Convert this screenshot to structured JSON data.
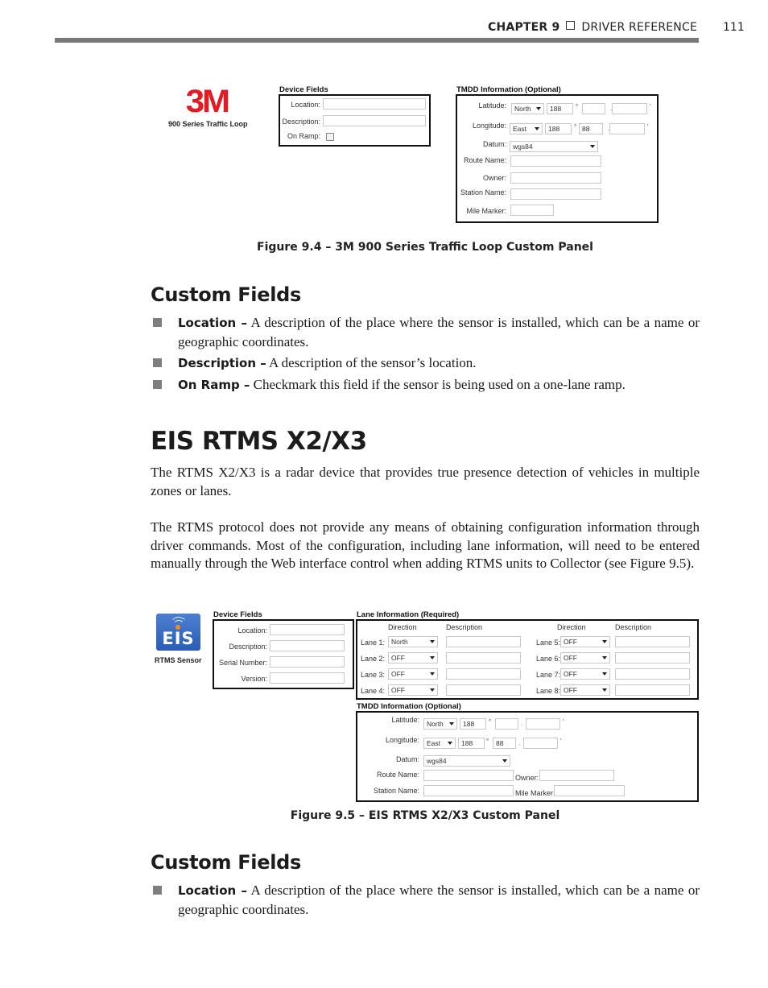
{
  "header": {
    "chapter": "CHAPTER 9",
    "section": "DRIVER REFERENCE",
    "page_number": "111"
  },
  "figure_94": {
    "logo_text": "3M",
    "device_name": "900 Series Traffic Loop",
    "device_fields": {
      "title": "Device Fields",
      "location_label": "Location:",
      "location_value": "",
      "description_label": "Description:",
      "description_value": "",
      "on_ramp_label": "On Ramp:",
      "on_ramp_checked": false
    },
    "tmdd": {
      "title": "TMDD Information (Optional)",
      "latitude_label": "Latitude:",
      "latitude_dir": "North",
      "latitude_deg": "188",
      "latitude_min": "",
      "latitude_sec": "",
      "longitude_label": "Longitude:",
      "longitude_dir": "East",
      "longitude_deg": "188",
      "longitude_min": "88",
      "longitude_sec": "",
      "datum_label": "Datum:",
      "datum_value": "wgs84",
      "route_name_label": "Route Name:",
      "owner_label": "Owner:",
      "station_name_label": "Station Name:",
      "mile_marker_label": "Mile Marker:",
      "deg_symbol": "°",
      "dot": ".",
      "min_symbol": "'"
    },
    "caption": "Figure 9.4 – 3M 900 Series Traffic Loop Custom Panel"
  },
  "section1": {
    "heading": "Custom Fields",
    "bullets": [
      {
        "term": "Location –",
        "text": " A description of the place where the sensor is installed, which can be a name or geographic coordinates."
      },
      {
        "term": "Description –",
        "text": " A description of the sensor’s location."
      },
      {
        "term": "On Ramp –",
        "text": " Checkmark this field if the sensor is being used on a one-lane ramp."
      }
    ]
  },
  "eis_section": {
    "heading": "EIS RTMS X2/X3",
    "para1": "The RTMS X2/X3 is a radar device that provides true presence detection of vehicles in multiple zones or lanes.",
    "para2": "The RTMS protocol does not provide any means of obtaining configuration information through driver commands. Most of the configuration, including lane information, will need to be entered manually through the Web interface control when adding RTMS units to Collector (see Figure 9.5)."
  },
  "figure_95": {
    "logo_text": "EIS",
    "device_name": "RTMS Sensor",
    "device_fields": {
      "title": "Device Fields",
      "location_label": "Location:",
      "description_label": "Description:",
      "serial_label": "Serial Number:",
      "version_label": "Version:"
    },
    "lanes": {
      "title": "Lane Information (Required)",
      "direction_header": "Direction",
      "description_header": "Description",
      "items": [
        {
          "label": "Lane 1:",
          "direction": "North",
          "description": ""
        },
        {
          "label": "Lane 2:",
          "direction": "OFF",
          "description": ""
        },
        {
          "label": "Lane 3:",
          "direction": "OFF",
          "description": ""
        },
        {
          "label": "Lane 4:",
          "direction": "OFF",
          "description": ""
        },
        {
          "label": "Lane 5:",
          "direction": "OFF",
          "description": ""
        },
        {
          "label": "Lane 6:",
          "direction": "OFF",
          "description": ""
        },
        {
          "label": "Lane 7:",
          "direction": "OFF",
          "description": ""
        },
        {
          "label": "Lane 8:",
          "direction": "OFF",
          "description": ""
        }
      ]
    },
    "tmdd": {
      "title": "TMDD Information (Optional)",
      "latitude_label": "Latitude:",
      "latitude_dir": "North",
      "latitude_deg": "188",
      "longitude_label": "Longitude:",
      "longitude_dir": "East",
      "longitude_deg": "188",
      "longitude_min": "88",
      "datum_label": "Datum:",
      "datum_value": "wgs84",
      "route_name_label": "Route Name:",
      "owner_label": "Owner:",
      "station_name_label": "Station Name:",
      "mile_marker_label": "Mile Marker:",
      "deg_symbol": "°",
      "dot": ".",
      "min_symbol": "'"
    },
    "caption": "Figure 9.5 – EIS RTMS X2/X3 Custom Panel"
  },
  "section2": {
    "heading": "Custom Fields",
    "bullets": [
      {
        "term": "Location –",
        "text": " A description of the place where the sensor is installed, which can be a name or geographic coordinates."
      }
    ]
  }
}
